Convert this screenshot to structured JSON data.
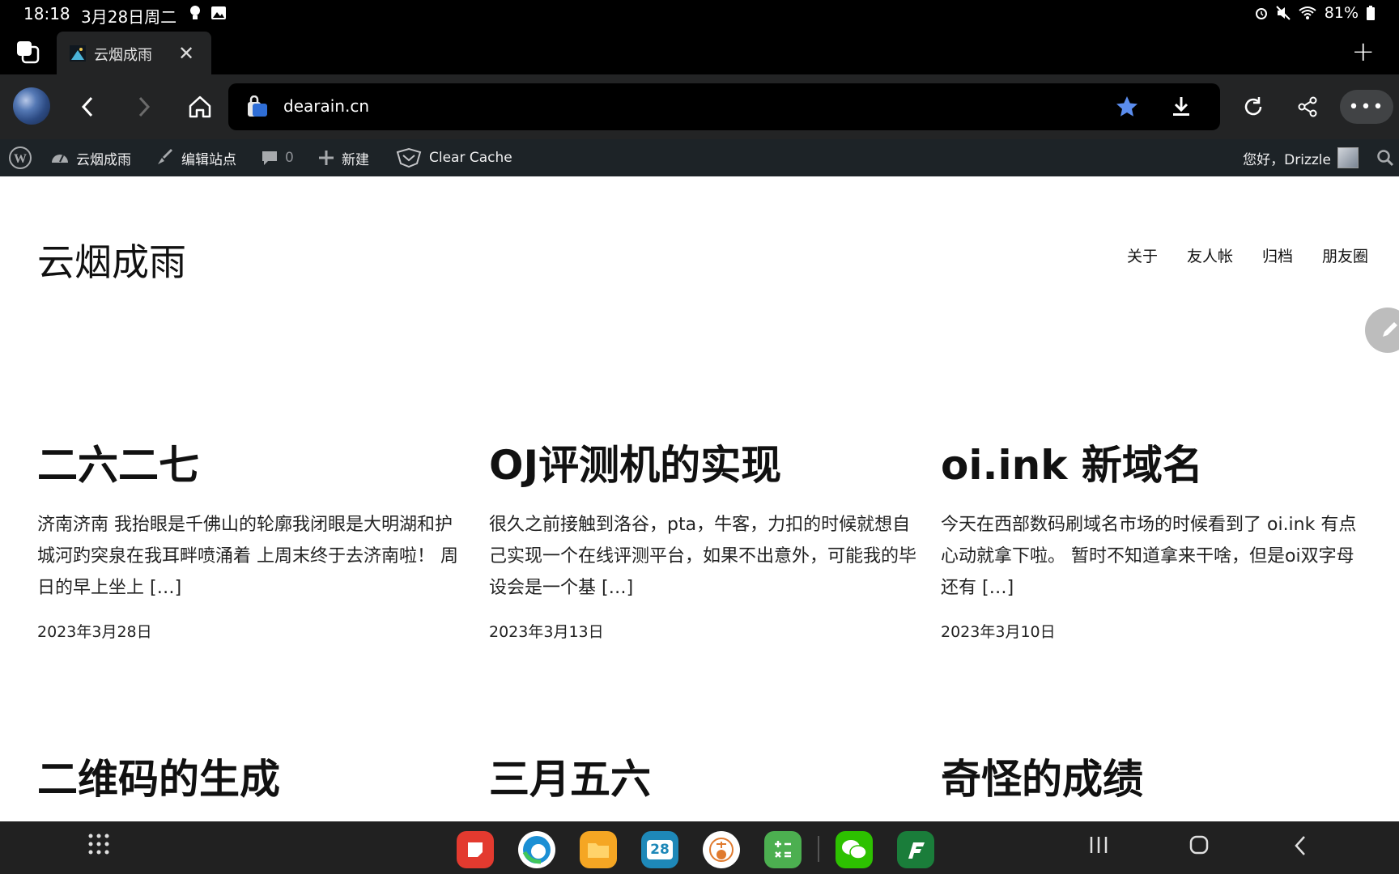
{
  "status_bar": {
    "time": "18:18",
    "date": "3月28日周二",
    "battery": "81%"
  },
  "browser": {
    "tab_title": "云烟成雨",
    "url": "dearain.cn"
  },
  "wp_admin_bar": {
    "site_name": "云烟成雨",
    "customize": "编辑站点",
    "comments_count": "0",
    "new_label": "新建",
    "clear_cache": "Clear Cache",
    "greeting": "您好，Drizzle"
  },
  "site": {
    "title": "云烟成雨",
    "nav": [
      "关于",
      "友人帐",
      "归档",
      "朋友圈"
    ]
  },
  "posts": [
    {
      "title": "二六二七",
      "excerpt": "济南济南 我抬眼是千佛山的轮廓我闭眼是大明湖和护城河趵突泉在我耳畔喷涌着 上周末终于去济南啦！ 周日的早上坐上 […]",
      "date": "2023年3月28日"
    },
    {
      "title": "OJ评测机的实现",
      "excerpt": "很久之前接触到洛谷，pta，牛客，力扣的时候就想自己实现一个在线评测平台，如果不出意外，可能我的毕设会是一个基 […]",
      "date": "2023年3月13日"
    },
    {
      "title": "oi.ink 新域名",
      "excerpt": "今天在西部数码刷域名市场的时候看到了 oi.ink 有点心动就拿下啦。 暂时不知道拿来干啥，但是oi双字母还有 […]",
      "date": "2023年3月10日"
    },
    {
      "title": "二维码的生成"
    },
    {
      "title": "三月五六"
    },
    {
      "title": "奇怪的成绩"
    }
  ],
  "taskbar": {
    "calendar_day": "28"
  },
  "colors": {
    "chrome_bg": "#000000",
    "toolbar_bg": "#232425",
    "wp_bar_bg": "#1d2327",
    "star_accent": "#5b8dee"
  }
}
